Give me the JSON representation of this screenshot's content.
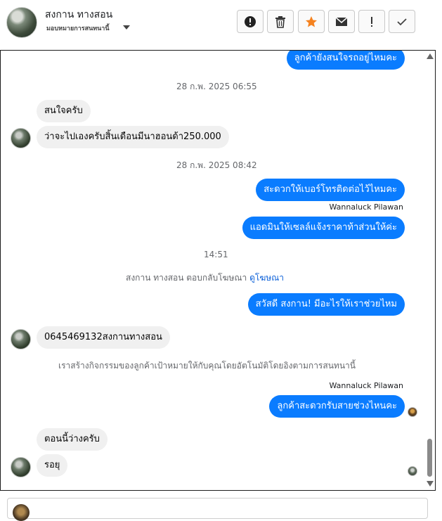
{
  "header": {
    "contact_name": "สงกาน ทางสอน",
    "assign_label": "มอบหมายการสนทนานี้",
    "toolbar": [
      "report-icon",
      "trash-icon",
      "star-icon",
      "mail-icon",
      "exclamation-icon",
      "check-icon"
    ]
  },
  "colors": {
    "outgoing_bubble": "#0a7cff",
    "incoming_bubble": "#f0f0f0",
    "star": "#f5821f"
  },
  "messages": [
    {
      "dir": "out",
      "text": "ลูกค้ายังสนใจรถอยู่ไหมคะ"
    },
    {
      "type": "time",
      "text": "28 ก.พ. 2025 06:55"
    },
    {
      "dir": "in",
      "text": "สนใจครับ"
    },
    {
      "dir": "in",
      "text": "ว่าจะไปเองครับสิ้นเดือนมีนาฮอนด้า250.000"
    },
    {
      "type": "time",
      "text": "28 ก.พ. 2025 08:42"
    },
    {
      "dir": "out",
      "text": "สะดวกให้เบอร์โทรติดต่อไว้ไหมคะ"
    },
    {
      "type": "sender",
      "text": "Wannaluck Pilawan"
    },
    {
      "dir": "out",
      "text": "แอดมินให้เซลล์แจ้งราคาท้าส่วนให้ค่ะ"
    },
    {
      "type": "time",
      "text": "14:51"
    },
    {
      "type": "system",
      "text": "สงกาน ทางสอน ตอบกลับโฆษณา",
      "link": "ดูโฆษณา"
    },
    {
      "dir": "out",
      "text": "สวัสดี สงกาน! มีอะไรให้เราช่วยไหม"
    },
    {
      "dir": "in",
      "text": "0645469132สงกานทางสอน"
    },
    {
      "type": "system",
      "text": "เราสร้างกิจกรรมของลูกค้าเป้าหมายให้กับคุณโดยอัตโนมัติโดยอิงตามการสนทนานี้"
    },
    {
      "type": "sender",
      "text": "Wannaluck Pilawan"
    },
    {
      "dir": "out",
      "text": "ลูกค้าสะดวกรับสายช่วงไหนคะ"
    },
    {
      "dir": "in",
      "text": "ตอนนี้ว่างครับ"
    },
    {
      "dir": "in",
      "text": "รอยุ"
    }
  ]
}
